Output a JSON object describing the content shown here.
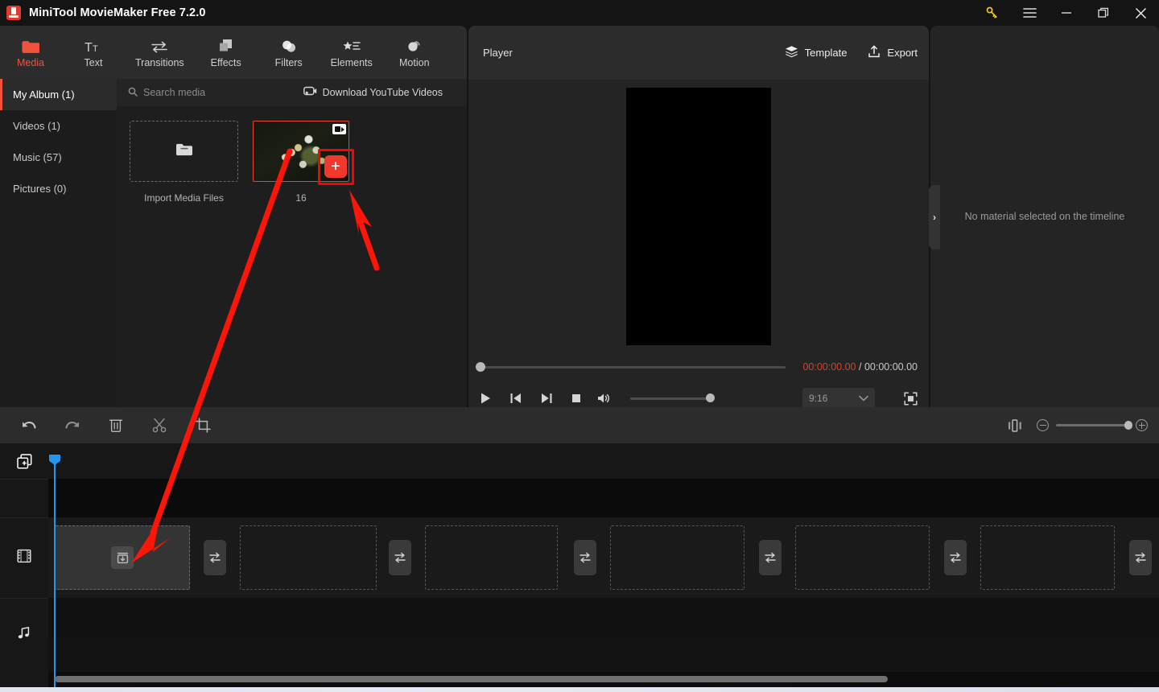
{
  "window": {
    "title": "MiniTool MovieMaker Free 7.2.0",
    "logo_icon": "app-logo-icon",
    "controls": [
      {
        "name": "key-icon",
        "label": "Activate"
      },
      {
        "name": "menu-icon",
        "label": "Menu"
      },
      {
        "name": "minimize-icon",
        "label": "Minimize"
      },
      {
        "name": "maximize-icon",
        "label": "Maximize"
      },
      {
        "name": "close-icon",
        "label": "Close"
      }
    ]
  },
  "toolbar": {
    "tabs": [
      {
        "label": "Media",
        "icon": "folder-icon",
        "active": true
      },
      {
        "label": "Text",
        "icon": "text-icon",
        "active": false
      },
      {
        "label": "Transitions",
        "icon": "transitions-icon",
        "active": false
      },
      {
        "label": "Effects",
        "icon": "effects-icon",
        "active": false
      },
      {
        "label": "Filters",
        "icon": "filters-icon",
        "active": false
      },
      {
        "label": "Elements",
        "icon": "elements-icon",
        "active": false
      },
      {
        "label": "Motion",
        "icon": "motion-icon",
        "active": false
      }
    ]
  },
  "library": {
    "categories": [
      {
        "label": "My Album (1)",
        "active": true
      },
      {
        "label": "Videos (1)",
        "active": false
      },
      {
        "label": "Music (57)",
        "active": false
      },
      {
        "label": "Pictures (0)",
        "active": false
      }
    ],
    "search_placeholder": "Search media",
    "search_icon": "search-icon",
    "download_youtube": "Download YouTube Videos",
    "download_icon": "youtube-download-icon",
    "import_label": "Import Media Files",
    "import_icon": "folder-open-icon",
    "items": [
      {
        "name": "16",
        "type": "video",
        "badge_icon": "video-camera-icon",
        "add_icon": "plus-icon",
        "selected": true,
        "highlighted": true
      }
    ]
  },
  "player": {
    "title": "Player",
    "template_label": "Template",
    "template_icon": "layers-icon",
    "export_label": "Export",
    "export_icon": "export-upload-icon",
    "current_time": "00:00:00.00",
    "separator": "/",
    "total_time": "00:00:00.00",
    "seek_percent": 0,
    "volume_percent": 100,
    "aspect_ratio": "9:16",
    "aspect_chevron_icon": "chevron-down-icon",
    "fullscreen_icon": "fullscreen-icon",
    "controls": [
      {
        "name": "play-button",
        "icon": "play-icon"
      },
      {
        "name": "prev-frame-button",
        "icon": "skip-back-icon"
      },
      {
        "name": "next-frame-button",
        "icon": "skip-forward-icon"
      },
      {
        "name": "stop-button",
        "icon": "stop-icon"
      },
      {
        "name": "volume-button",
        "icon": "speaker-icon"
      }
    ]
  },
  "right_panel": {
    "empty_message": "No material selected on the timeline",
    "collapse_icon": "chevron-right-icon"
  },
  "timeline_toolbar": {
    "buttons": [
      {
        "name": "undo-button",
        "icon": "undo-icon"
      },
      {
        "name": "redo-button",
        "icon": "redo-icon"
      },
      {
        "name": "delete-button",
        "icon": "trash-icon"
      },
      {
        "name": "split-button",
        "icon": "scissors-icon"
      },
      {
        "name": "crop-button",
        "icon": "crop-icon"
      }
    ],
    "fit_icon": "fit-timeline-icon",
    "zoom_out_icon": "zoom-out-icon",
    "zoom_in_icon": "zoom-in-icon",
    "zoom_percent": 100
  },
  "timeline": {
    "add_track_icon": "add-media-icon",
    "tracks": [
      {
        "name": "video-track",
        "icon": "film-icon"
      },
      {
        "name": "audio-track",
        "icon": "music-note-icon"
      }
    ],
    "playhead_position": "00:00:00.00",
    "video_slots": [
      {
        "filled": true,
        "icon": "download-into-slot-icon"
      },
      {
        "filled": false,
        "icon": ""
      },
      {
        "filled": false,
        "icon": ""
      },
      {
        "filled": false,
        "icon": ""
      },
      {
        "filled": false,
        "icon": ""
      },
      {
        "filled": false,
        "icon": ""
      }
    ],
    "transition_slots": 6,
    "transition_icon": "transition-swap-icon"
  },
  "annotations": {
    "arrow_long_label": "arrow-pointing-to-timeline-slot",
    "arrow_short_label": "arrow-pointing-to-add-button",
    "highlight_color": "#ff0000"
  },
  "colors": {
    "accent": "#f2523c",
    "window_bg": "#141414",
    "panel_bg": "#242424",
    "toolbar_bg": "#2c2c2c",
    "library_bg": "#1e1e1e",
    "timeline_bg": "#101010",
    "playhead": "#2196f3",
    "time_current": "#d8412f"
  }
}
